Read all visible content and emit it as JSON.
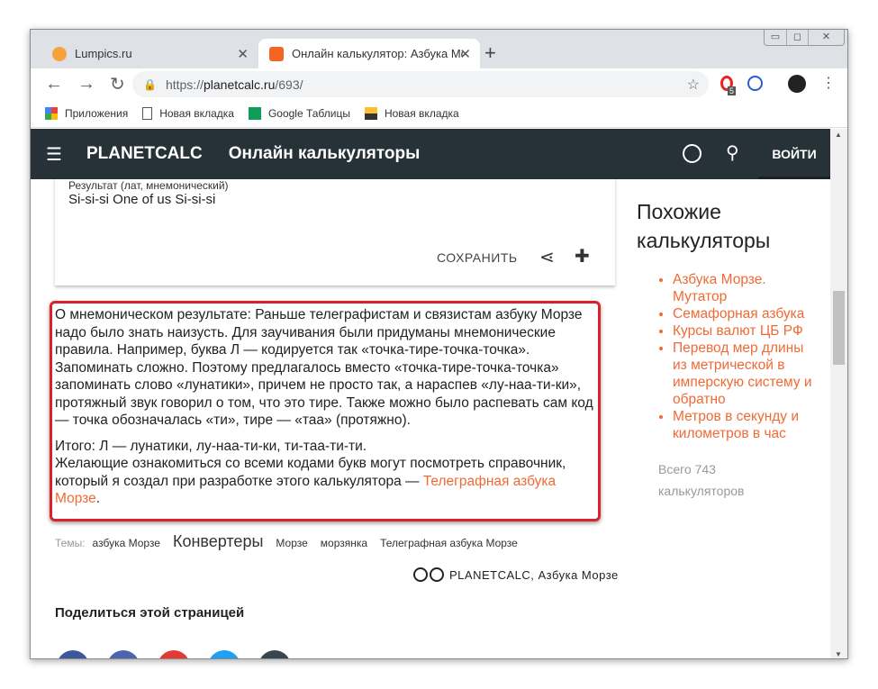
{
  "browser": {
    "tabs": [
      {
        "title": "Lumpics.ru",
        "favicon_color": "#f7a13a"
      },
      {
        "title": "Онлайн калькулятор: Азбука Mc",
        "favicon_color": "#f26522"
      }
    ],
    "new_tab": "+",
    "url_scheme": "https://",
    "url_host": "planetcalc.ru",
    "url_path": "/693/",
    "extension_badge": "5",
    "bookmarks": [
      "Приложения",
      "Новая вкладка",
      "Google Таблицы",
      "Новая вкладка"
    ]
  },
  "header": {
    "logo": "PLANETCALC",
    "title": "Онлайн калькуляторы",
    "login": "ВОЙТИ"
  },
  "result": {
    "label": "Результат (лат, мнемонический)",
    "value": "Si-si-si One of us Si-si-si",
    "save": "СОХРАНИТЬ"
  },
  "note": {
    "p1": "О мнемоническом результате: Раньше телеграфистам и связистам азбуку Морзе надо было знать наизусть. Для заучивания были придуманы мнемонические правила. Например, буква Л — кодируется так «точка-тире-точка-точка». Запоминать сложно. Поэтому предлагалось вместо «точка-тире-точка-точка» запоминать слово «лунатики», причем не просто так, а нараспев «лу-наа-ти-ки», протяжный звук говорил о том, что это тире. Также можно было распевать сам код — точка обозначалась «ти», тире — «таа» (протяжно).",
    "p2": "Итого: Л — лунатики, лу-наа-ти-ки, ти-таа-ти-ти.",
    "p3": "Желающие ознакомиться со всеми кодами букв могут посмотреть справочник, который я создал при разработке этого калькулятора — ",
    "link": "Телеграфная азбука Морзе",
    "end": "."
  },
  "tags": {
    "label": "Темы:",
    "items": [
      "азбука Морзе",
      "Конвертеры",
      "Морзе",
      "морзянка",
      "Телеграфная азбука Морзе"
    ]
  },
  "license": "PLANETCALC, Азбука Морзе",
  "share": {
    "title": "Поделиться этой страницей",
    "colors": [
      "#3b5998",
      "#4a66ad",
      "#e53935",
      "#1da1f2",
      "#37474f"
    ]
  },
  "sidebar": {
    "title": "Похожие калькуляторы",
    "links": [
      "Азбука Морзе. Мутатор",
      "Семафорная азбука",
      "Курсы валют ЦБ РФ",
      "Перевод мер длины из метрической в имперскую систему и обратно",
      "Метров в секунду и километров в час"
    ],
    "total": "Всего 743 калькуляторов"
  }
}
